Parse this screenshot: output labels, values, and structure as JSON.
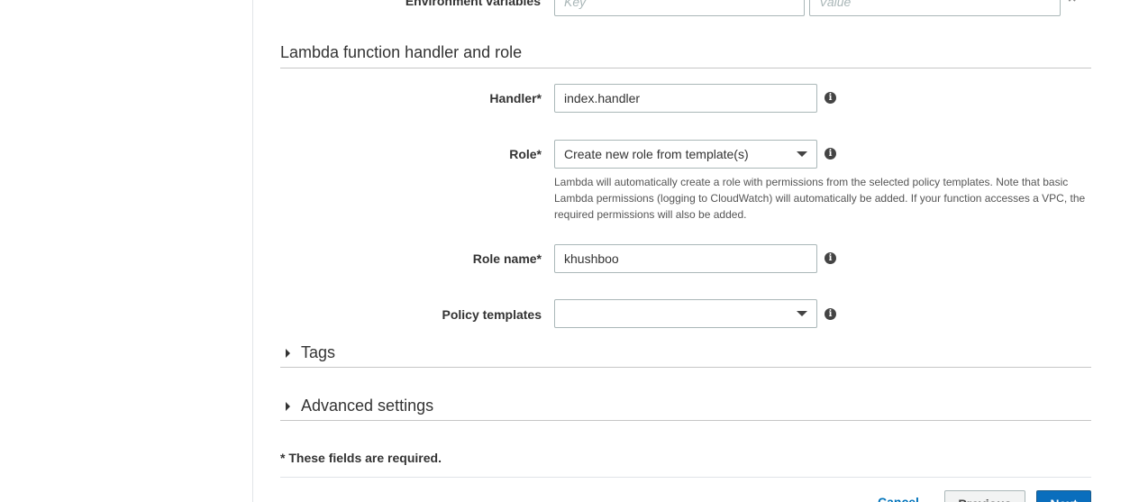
{
  "env_vars": {
    "label": "Environment variables",
    "key_placeholder": "Key",
    "value_placeholder": "Value"
  },
  "section": {
    "title": "Lambda function handler and role"
  },
  "handler": {
    "label": "Handler*",
    "value": "index.handler"
  },
  "role": {
    "label": "Role*",
    "selected": "Create new role from template(s)",
    "help": "Lambda will automatically create a role with permissions from the selected policy templates. Note that basic Lambda permissions (logging to CloudWatch) will automatically be added. If your function accesses a VPC, the required permissions will also be added."
  },
  "role_name": {
    "label": "Role name*",
    "value": "khushboo"
  },
  "policy_templates": {
    "label": "Policy templates",
    "selected": ""
  },
  "tags": {
    "label": "Tags"
  },
  "advanced": {
    "label": "Advanced settings"
  },
  "required_note": "* These fields are required.",
  "footer": {
    "cancel": "Cancel",
    "previous": "Previous",
    "next": "Next"
  },
  "icons": {
    "info": "info-icon",
    "remove": "close-icon",
    "caret_down": "chevron-down-icon",
    "caret_right": "chevron-right-icon"
  },
  "colors": {
    "primary_button": "#0a6ebd",
    "link": "#0073bb",
    "border": "#aab7b8"
  }
}
